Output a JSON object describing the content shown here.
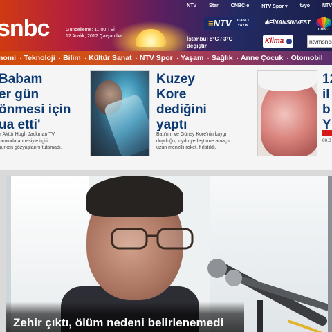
{
  "header": {
    "logo_text": "snbc",
    "update_line1": "Güncelleme: 11:00 TSİ",
    "update_line2": "12 Aralık, 2012 Çarşamba",
    "top_links": [
      "NTV",
      "Star",
      "CNBC-e",
      "NTV Spor ▾",
      "tvyo",
      "NTV"
    ],
    "ntv_badge": {
      "ntv": "NTV",
      "live_line1": "CANLI",
      "live_line2": "YAYIN"
    },
    "finans_label": "FİNANSINVEST",
    "nbc_label": "CNBC",
    "weather_line1": "İstanbul 8°C / 3°C",
    "weather_line2": "değiştir",
    "klima_label": "Klima",
    "search_placeholder": "ntvmsnbc"
  },
  "nav": {
    "items": [
      "nomi",
      "Teknoloji",
      "Bilim",
      "Kültür Sanat",
      "NTV Spor",
      "Yaşam",
      "Sağlık",
      "Anne Çocuk",
      "Otomobil"
    ]
  },
  "teasers": [
    {
      "title": "Babam\ner gün\nönmesi için\nua etti'",
      "summary": "» Aktör Hugh Jackman TV\nramında annesiyle ilgili\nşurken gözyaşlarını tutamadı."
    },
    {
      "title": "Kuzey\nKore\ndediğini\nyaptı",
      "summary": "Batı'nın ve Güney Kore'nin kaygı\nduyduğu, 'uydu yerleştirme amaçlı'\nuzun menzilli roket, fırlatıldı."
    },
    {
      "title": "12\nil\nb\nY",
      "time": "00.0"
    }
  ],
  "main_story": {
    "caption": "Zehir çıktı, ölüm nedeni belirlenemedi"
  },
  "colors": {
    "title_blue": "#0e3a73",
    "nav_orange": "#d14a0a",
    "header_dark": "#1a1f4a"
  }
}
